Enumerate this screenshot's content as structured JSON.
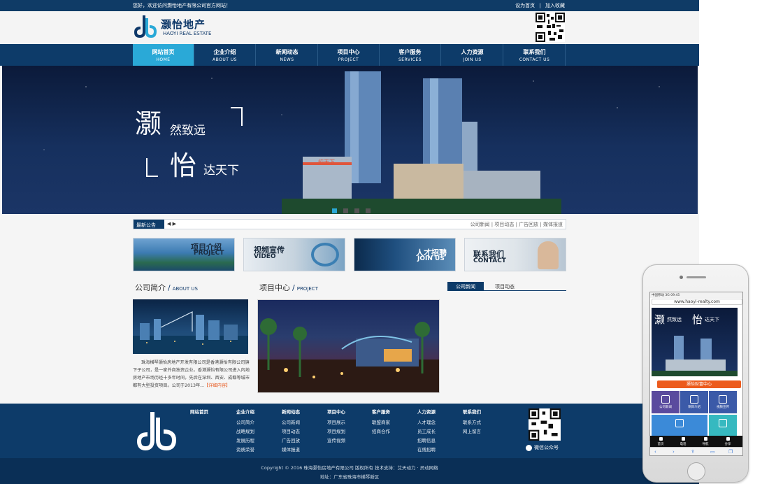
{
  "topbar": {
    "welcome": "您好，欢迎访问灏怡地产有限公司官方网站！",
    "links": [
      "设为首页",
      "|",
      "加入收藏"
    ]
  },
  "header": {
    "logo_cn": "灏怡地产",
    "logo_en": "HAOYI REAL ESTATE"
  },
  "nav": [
    {
      "cn": "网站首页",
      "en": "HOME",
      "active": true
    },
    {
      "cn": "企业介绍",
      "en": "ABOUT US"
    },
    {
      "cn": "新闻动态",
      "en": "NEWS"
    },
    {
      "cn": "项目中心",
      "en": "PROJECT"
    },
    {
      "cn": "客户服务",
      "en": "SERVICES"
    },
    {
      "cn": "人力资源",
      "en": "JOIN US"
    },
    {
      "cn": "联系我们",
      "en": "CONTACT US"
    }
  ],
  "banner": {
    "big1": "灏",
    "line1": "然致远",
    "big2": "怡",
    "line2": "达天下",
    "sign": "纯天下"
  },
  "notice": {
    "label": "最新公告",
    "arrows": "◀ ▶",
    "links": "公司新闻 | 项目动态 | 广告回放 | 媒体报道"
  },
  "promos": [
    {
      "cn": "项目介绍",
      "en": "PROJECT"
    },
    {
      "cn": "视频宣传",
      "en": "VIDEO"
    },
    {
      "cn": "人才招聘",
      "en": "JOIN US"
    },
    {
      "cn": "联系我们",
      "en": "CONTACT"
    }
  ],
  "about": {
    "title": "公司简介",
    "sep": "/",
    "en": "ABOUT US",
    "text": "珠海横琴灏怡房地产开发有限公司是香港灏怡有限公司旗下子公司，是一家外商独资企业。香港灏怡有限公司进入内地房地产市场历经十多年时间，先后在深圳、西安、成都等城市都有大型投资项目。公司于2013年...",
    "more": "【详细内容】"
  },
  "project": {
    "title": "项目中心",
    "sep": "/",
    "en": "PROJECT"
  },
  "news_tabs": [
    "公司新闻",
    "项目动态"
  ],
  "footer": {
    "cols": [
      {
        "hd": "网站首页",
        "items": []
      },
      {
        "hd": "企业介绍",
        "items": [
          "公司简介",
          "战略规划",
          "发展历程",
          "资质荣誉"
        ]
      },
      {
        "hd": "新闻动态",
        "items": [
          "公司新闻",
          "项目动态",
          "广告回放",
          "媒体报道"
        ]
      },
      {
        "hd": "项目中心",
        "items": [
          "项目展示",
          "项目规划",
          "宣传视频"
        ]
      },
      {
        "hd": "客户服务",
        "items": [
          "联盟商家",
          "招商合作"
        ]
      },
      {
        "hd": "人力资源",
        "items": [
          "人才理念",
          "员工成长",
          "招聘信息",
          "在线招聘"
        ]
      },
      {
        "hd": "联系我们",
        "items": [
          "联系方式",
          "网上留言"
        ]
      }
    ],
    "wechat": "微信公众号"
  },
  "copyright": {
    "line1": "Copyright © 2016 珠海灏怡房地产有限公司 版权所有  技术支持：艾天动力 · 灵动网络",
    "line2": "地址：广东省珠海市横琴新区"
  },
  "phone": {
    "status": "中国移动 3G  09:45",
    "url": "www.haoyi-realty.com",
    "banner_big1": "灏",
    "banner_line1": "然致远",
    "banner_big2": "怡",
    "banner_line2": "达天下",
    "bar": "灏怡财富中心",
    "tiles": [
      {
        "label": "公司新闻",
        "color": "#5a4a9e"
      },
      {
        "label": "项目介绍",
        "color": "#3b5aa8"
      },
      {
        "label": "视频宣传",
        "color": "#3b5aa8"
      },
      {
        "label": "",
        "color": "#3b8ad8"
      },
      {
        "label": "",
        "color": "#36b9c0"
      }
    ],
    "tabbar": [
      "首页",
      "电话",
      "导航",
      "分享"
    ]
  },
  "colors": {
    "navy": "#0d3b69",
    "accent": "#2aa9d7",
    "orange": "#ec5b1d"
  }
}
